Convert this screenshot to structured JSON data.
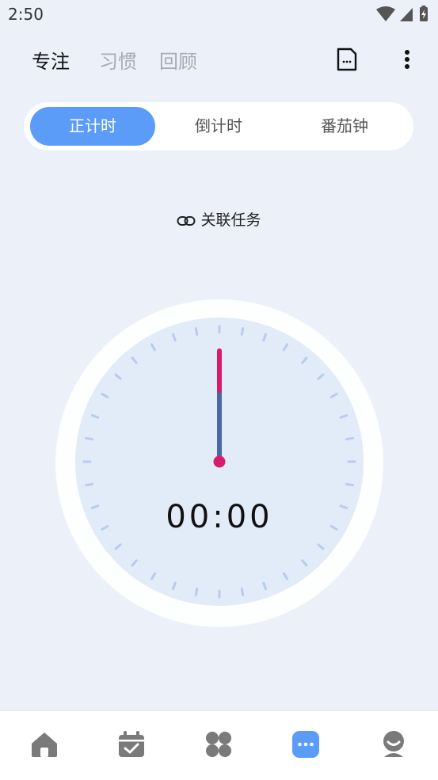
{
  "status_bar": {
    "time": "2:50",
    "icons": [
      "wifi-icon",
      "signal-icon",
      "battery-charging-icon"
    ]
  },
  "header": {
    "tabs": [
      {
        "label": "专注",
        "active": true
      },
      {
        "label": "习惯",
        "active": false
      },
      {
        "label": "回顾",
        "active": false
      }
    ],
    "actions": [
      "document-icon",
      "more-vertical-icon"
    ]
  },
  "mode_switch": {
    "options": [
      {
        "label": "正计时",
        "active": true
      },
      {
        "label": "倒计时",
        "active": false
      },
      {
        "label": "番茄钟",
        "active": false
      }
    ]
  },
  "link_task": {
    "label": "关联任务",
    "icon": "link-icon"
  },
  "timer": {
    "display": "00:00"
  },
  "bottom_nav": {
    "items": [
      {
        "icon": "home-icon",
        "active": false
      },
      {
        "icon": "calendar-check-icon",
        "active": false
      },
      {
        "icon": "apps-icon",
        "active": false
      },
      {
        "icon": "focus-icon",
        "active": true
      },
      {
        "icon": "profile-icon",
        "active": false
      }
    ]
  },
  "colors": {
    "accent": "#5B9CF9",
    "hand_pink": "#D81B6A",
    "hand_blue": "#4A67AA",
    "background": "#ECF0F8",
    "dial": "#E2EBF8",
    "tick": "#B7CCEE",
    "nav_inactive": "#7a7a7a"
  }
}
